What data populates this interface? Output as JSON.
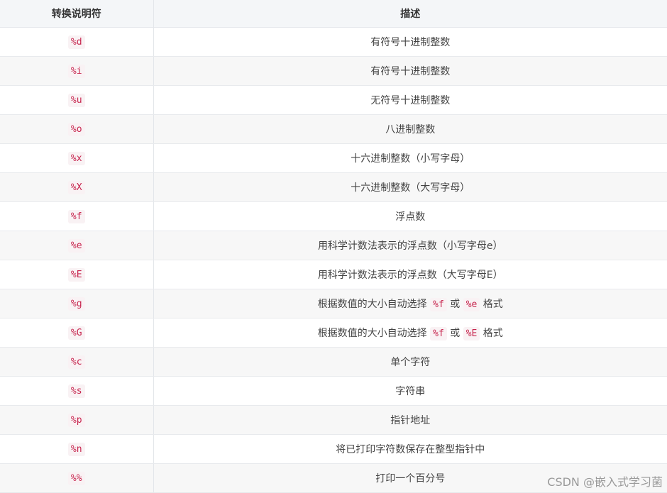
{
  "table": {
    "headers": [
      "转换说明符",
      "描述"
    ],
    "rows": [
      {
        "spec": "%d",
        "desc": [
          "有符号十进制整数"
        ]
      },
      {
        "spec": "%i",
        "desc": [
          "有符号十进制整数"
        ]
      },
      {
        "spec": "%u",
        "desc": [
          "无符号十进制整数"
        ]
      },
      {
        "spec": "%o",
        "desc": [
          "八进制整数"
        ]
      },
      {
        "spec": "%x",
        "desc": [
          "十六进制整数（小写字母）"
        ]
      },
      {
        "spec": "%X",
        "desc": [
          "十六进制整数（大写字母）"
        ]
      },
      {
        "spec": "%f",
        "desc": [
          "浮点数"
        ]
      },
      {
        "spec": "%e",
        "desc": [
          "用科学计数法表示的浮点数（小写字母e）"
        ]
      },
      {
        "spec": "%E",
        "desc": [
          "用科学计数法表示的浮点数（大写字母E）"
        ]
      },
      {
        "spec": "%g",
        "desc": [
          "根据数值的大小自动选择 ",
          {
            "code": "%f"
          },
          " 或 ",
          {
            "code": "%e"
          },
          " 格式"
        ]
      },
      {
        "spec": "%G",
        "desc": [
          "根据数值的大小自动选择 ",
          {
            "code": "%f"
          },
          " 或 ",
          {
            "code": "%E"
          },
          " 格式"
        ]
      },
      {
        "spec": "%c",
        "desc": [
          "单个字符"
        ]
      },
      {
        "spec": "%s",
        "desc": [
          "字符串"
        ]
      },
      {
        "spec": "%p",
        "desc": [
          "指针地址"
        ]
      },
      {
        "spec": "%n",
        "desc": [
          "将已打印字符数保存在整型指针中"
        ]
      },
      {
        "spec": "%%",
        "desc": [
          "打印一个百分号"
        ]
      }
    ]
  },
  "watermark": "CSDN @嵌入式学习菌"
}
